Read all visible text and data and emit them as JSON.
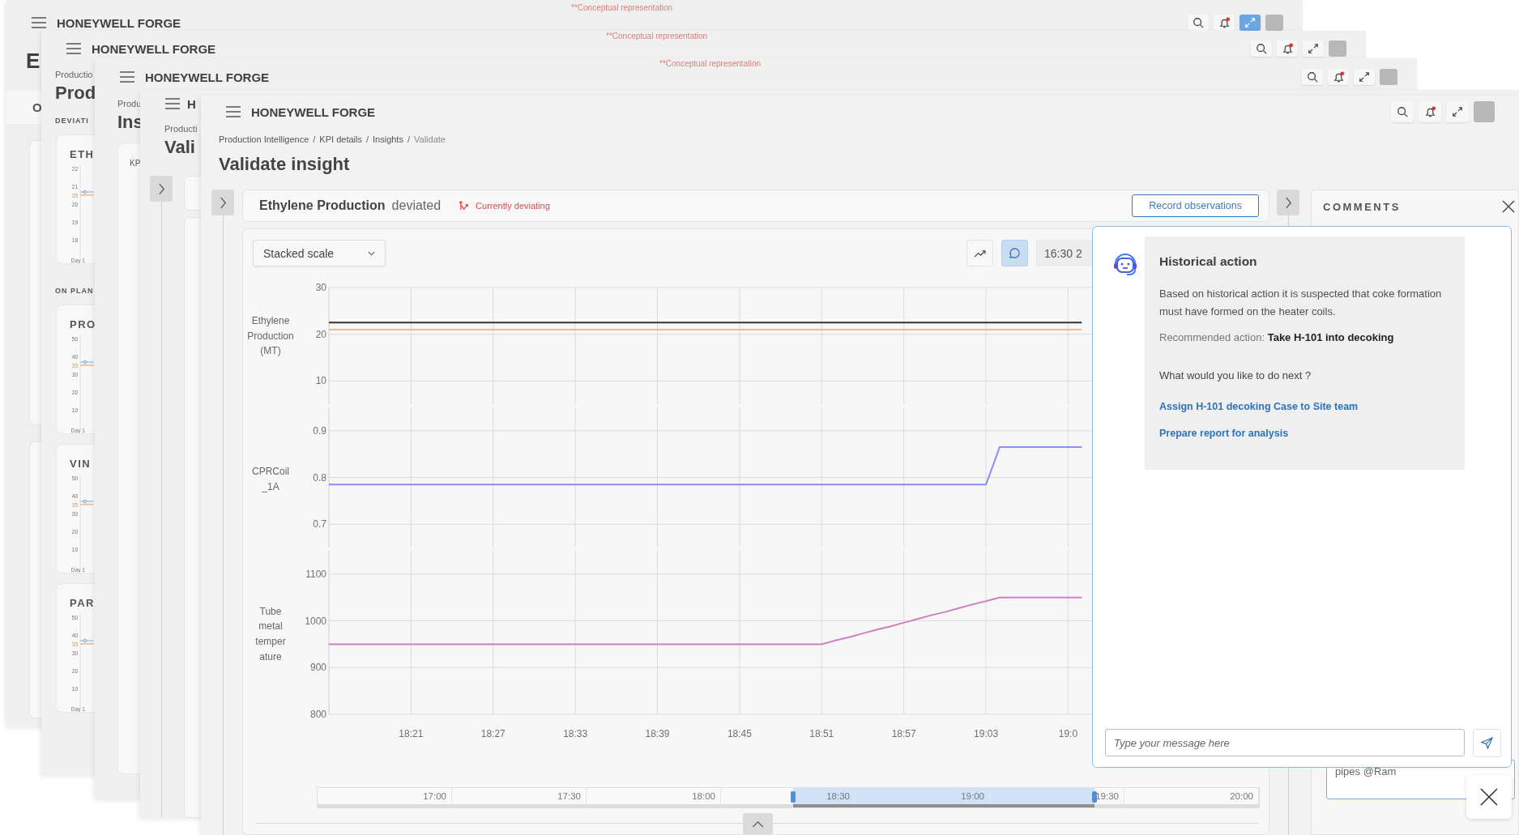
{
  "windows": [
    {
      "kind": "overview",
      "brand": "HONEYWELL FORGE",
      "note": "**Conceptual representation",
      "expand_selected": true,
      "title": "E",
      "tab": "O"
    },
    {
      "kind": "kpi_list",
      "brand": "HONEYWELL FORGE",
      "note": "**Conceptual representation",
      "expand_selected": false,
      "breadcrumb": "Productio",
      "title": "Prod",
      "sections": [
        {
          "label": "DEVIATI",
          "cards": [
            {
              "title": "ETH",
              "xlabel": "Day 1",
              "ticks": [
                {
                  "label": "22",
                  "kind": "axis"
                },
                {
                  "label": "21",
                  "kind": "axis"
                },
                {
                  "label": "35",
                  "kind": "target"
                },
                {
                  "label": "20",
                  "kind": "axis"
                },
                {
                  "label": "19",
                  "kind": "axis"
                },
                {
                  "label": "18",
                  "kind": "axis"
                }
              ]
            }
          ]
        },
        {
          "label": "ON PLAN",
          "cards": [
            {
              "title": "PRO",
              "xlabel": "Day 1",
              "ticks": [
                {
                  "label": "50",
                  "kind": "axis"
                },
                {
                  "label": "40",
                  "kind": "axis"
                },
                {
                  "label": "35",
                  "kind": "target"
                },
                {
                  "label": "30",
                  "kind": "axis"
                },
                {
                  "label": "20",
                  "kind": "axis"
                },
                {
                  "label": "10",
                  "kind": "axis"
                }
              ]
            },
            {
              "title": "VIN",
              "xlabel": "Day 1",
              "ticks": [
                {
                  "label": "50",
                  "kind": "axis"
                },
                {
                  "label": "40",
                  "kind": "axis"
                },
                {
                  "label": "35",
                  "kind": "target"
                },
                {
                  "label": "30",
                  "kind": "axis"
                },
                {
                  "label": "20",
                  "kind": "axis"
                },
                {
                  "label": "10",
                  "kind": "axis"
                }
              ]
            },
            {
              "title": "PAR",
              "xlabel": "Day 1",
              "ticks": [
                {
                  "label": "50",
                  "kind": "axis"
                },
                {
                  "label": "40",
                  "kind": "axis"
                },
                {
                  "label": "35",
                  "kind": "target"
                },
                {
                  "label": "30",
                  "kind": "axis"
                },
                {
                  "label": "20",
                  "kind": "axis"
                },
                {
                  "label": "10",
                  "kind": "axis"
                }
              ]
            }
          ]
        }
      ]
    },
    {
      "kind": "kpi_details",
      "brand": "HONEYWELL FORGE",
      "note": "**Conceptual representation",
      "expand_selected": false,
      "breadcrumb": "Produ",
      "title": "Ins",
      "card_label": "KP"
    },
    {
      "kind": "insights",
      "brand": "H",
      "breadcrumb": "Producti",
      "title": "Vali"
    }
  ],
  "app": {
    "brand": "HONEYWELL FORGE",
    "expand_selected": false,
    "breadcrumb": {
      "separator": "/",
      "items": [
        {
          "label": "Production Intelligence",
          "current": false
        },
        {
          "label": "KPI details",
          "current": false
        },
        {
          "label": "Insights",
          "current": false
        },
        {
          "label": "Validate",
          "current": true
        }
      ]
    },
    "title": "Validate insight",
    "insight": {
      "metric": "Ethylene Production",
      "status": "deviated",
      "badge": "Currently deviating",
      "button": "Record observations"
    },
    "chart": {
      "scale": "Stacked scale",
      "toolbar": [
        {
          "kind": "trend",
          "selected": false
        },
        {
          "kind": "comment",
          "selected": true
        }
      ],
      "time_range": "16:30 2",
      "panels": [
        {
          "chart_data": {
            "type": "line",
            "ylabel": "Ethylene Production (MT)",
            "grid": true,
            "categories": [
              null,
              null,
              null,
              null,
              null,
              null,
              null,
              null,
              null,
              null,
              null,
              null,
              null,
              null,
              null,
              null,
              null,
              null,
              null,
              null,
              null,
              null,
              null,
              null,
              null,
              null,
              null,
              null,
              null,
              null,
              null,
              null,
              null,
              null,
              null,
              null,
              null,
              null,
              null,
              null,
              null,
              null,
              null,
              null,
              null,
              null,
              null,
              null,
              null,
              null,
              null,
              null,
              null,
              null,
              null,
              null,
              null
            ],
            "ylim": [
              10,
              30
            ],
            "yticks": [
              10,
              20,
              30
            ],
            "series": [
              {
                "color": "#333333",
                "values": [
                  22.5,
                  22.5,
                  22.5,
                  22.5,
                  22.5,
                  22.5,
                  22.5,
                  22.5,
                  22.5,
                  22.5,
                  22.5,
                  22.5,
                  22.5,
                  22.5,
                  22.5,
                  22.5,
                  22.5,
                  22.5,
                  22.5,
                  22.5,
                  22.5,
                  22.5,
                  22.5,
                  22.5,
                  22.5,
                  22.5,
                  22.5,
                  22.5,
                  22.5,
                  22.5,
                  22.5,
                  22.5,
                  22.5,
                  22.5,
                  22.5,
                  22.5,
                  22.5,
                  22.5,
                  22.5,
                  22.5,
                  22.5,
                  22.5,
                  22.5,
                  22.5,
                  22.5,
                  22.5,
                  22.5,
                  22.5,
                  22.5,
                  22.5,
                  22.5,
                  22.5,
                  22.5,
                  22.5,
                  22.5,
                  22.5,
                  null
                ]
              },
              {
                "color": "#f2b88e",
                "values": [
                  21,
                  21,
                  21,
                  21,
                  21,
                  21,
                  21,
                  21,
                  21,
                  21,
                  21,
                  21,
                  21,
                  21,
                  21,
                  21,
                  21,
                  21,
                  21,
                  21,
                  21,
                  21,
                  21,
                  21,
                  21,
                  21,
                  21,
                  21,
                  21,
                  21,
                  21,
                  21,
                  21,
                  21,
                  21,
                  21,
                  21,
                  21,
                  21,
                  21,
                  21,
                  21,
                  21,
                  21,
                  21,
                  21,
                  21,
                  21,
                  21,
                  21,
                  21,
                  21,
                  21,
                  21,
                  21,
                  21,
                  null
                ]
              }
            ]
          }
        },
        {
          "chart_data": {
            "type": "line",
            "ylabel": "CPRCoil_1A",
            "grid": true,
            "categories": [
              null,
              null,
              null,
              null,
              null,
              null,
              null,
              null,
              null,
              null,
              null,
              null,
              null,
              null,
              null,
              null,
              null,
              null,
              null,
              null,
              null,
              null,
              null,
              null,
              null,
              null,
              null,
              null,
              null,
              null,
              null,
              null,
              null,
              null,
              null,
              null,
              null,
              null,
              null,
              null,
              null,
              null,
              null,
              null,
              null,
              null,
              null,
              null,
              null,
              null,
              null,
              null,
              null,
              null,
              null,
              null,
              null
            ],
            "ylim": [
              0.7,
              0.9
            ],
            "yticks": [
              0.7,
              0.8,
              0.9
            ],
            "series": [
              {
                "color": "#8b8cf7",
                "values": [
                  0.785,
                  0.785,
                  0.785,
                  0.785,
                  0.785,
                  0.785,
                  0.785,
                  0.785,
                  0.785,
                  0.785,
                  0.785,
                  0.785,
                  0.785,
                  0.785,
                  0.785,
                  0.785,
                  0.785,
                  0.785,
                  0.785,
                  0.785,
                  0.785,
                  0.785,
                  0.785,
                  0.785,
                  0.785,
                  0.785,
                  0.785,
                  0.785,
                  0.785,
                  0.785,
                  0.785,
                  0.785,
                  0.785,
                  0.785,
                  0.785,
                  0.785,
                  0.785,
                  0.785,
                  0.785,
                  0.785,
                  0.785,
                  0.785,
                  0.785,
                  0.785,
                  0.785,
                  0.785,
                  0.785,
                  0.785,
                  0.785,
                  0.865,
                  0.865,
                  0.865,
                  0.865,
                  0.865,
                  0.865,
                  0.865,
                  null
                ]
              }
            ]
          }
        },
        {
          "chart_data": {
            "type": "line",
            "ylabel": "Tube metal temperature",
            "grid": true,
            "ylim": [
              800,
              1100
            ],
            "yticks": [
              800,
              900,
              1000,
              1100
            ],
            "categories": [
              null,
              null,
              null,
              null,
              null,
              null,
              "18:21",
              null,
              null,
              null,
              null,
              null,
              "18:27",
              null,
              null,
              null,
              null,
              null,
              "18:33",
              null,
              null,
              null,
              null,
              null,
              "18:39",
              null,
              null,
              null,
              null,
              null,
              "18:45",
              null,
              null,
              null,
              null,
              null,
              "18:51",
              null,
              null,
              null,
              null,
              null,
              "18:57",
              null,
              null,
              null,
              null,
              null,
              "19:03",
              null,
              null,
              null,
              null,
              null,
              "19:0",
              null,
              null
            ],
            "series": [
              {
                "color": "#d27fc2",
                "values": [
                  950,
                  950,
                  950,
                  950,
                  950,
                  950,
                  950,
                  950,
                  950,
                  950,
                  950,
                  950,
                  950,
                  950,
                  950,
                  950,
                  950,
                  950,
                  950,
                  950,
                  950,
                  950,
                  950,
                  950,
                  950,
                  950,
                  950,
                  950,
                  950,
                  950,
                  950,
                  950,
                  950,
                  950,
                  950,
                  950,
                  950,
                  958,
                  965,
                  973,
                  981,
                  988,
                  996,
                  1004,
                  1012,
                  1019,
                  1027,
                  1035,
                  1042,
                  1050,
                  1050,
                  1050,
                  1050,
                  1050,
                  1050,
                  1050,
                  null
                ]
              }
            ]
          }
        }
      ],
      "navigator": {
        "labels": [
          "17:00",
          "17:30",
          "18:00",
          "18:30",
          "19:00",
          "19:30",
          "20:00"
        ],
        "handles": [
          {
            "level": 0.505
          },
          {
            "level": 0.825
          }
        ]
      }
    },
    "comments": {
      "title": "COMMENTS",
      "draft": "pipes @Ram"
    },
    "assistant": {
      "title": "Historical action",
      "body": "Based on historical action it is suspected that coke formation must have formed on the heater coils.",
      "recommendation": "Recommended action: **Take H-101 into decoking**",
      "question": "What would you like to do next ?",
      "actions": [
        "Assign H-101 decoking Case to Site team",
        "Prepare report for analysis"
      ],
      "placeholder": "Type your message here"
    }
  }
}
